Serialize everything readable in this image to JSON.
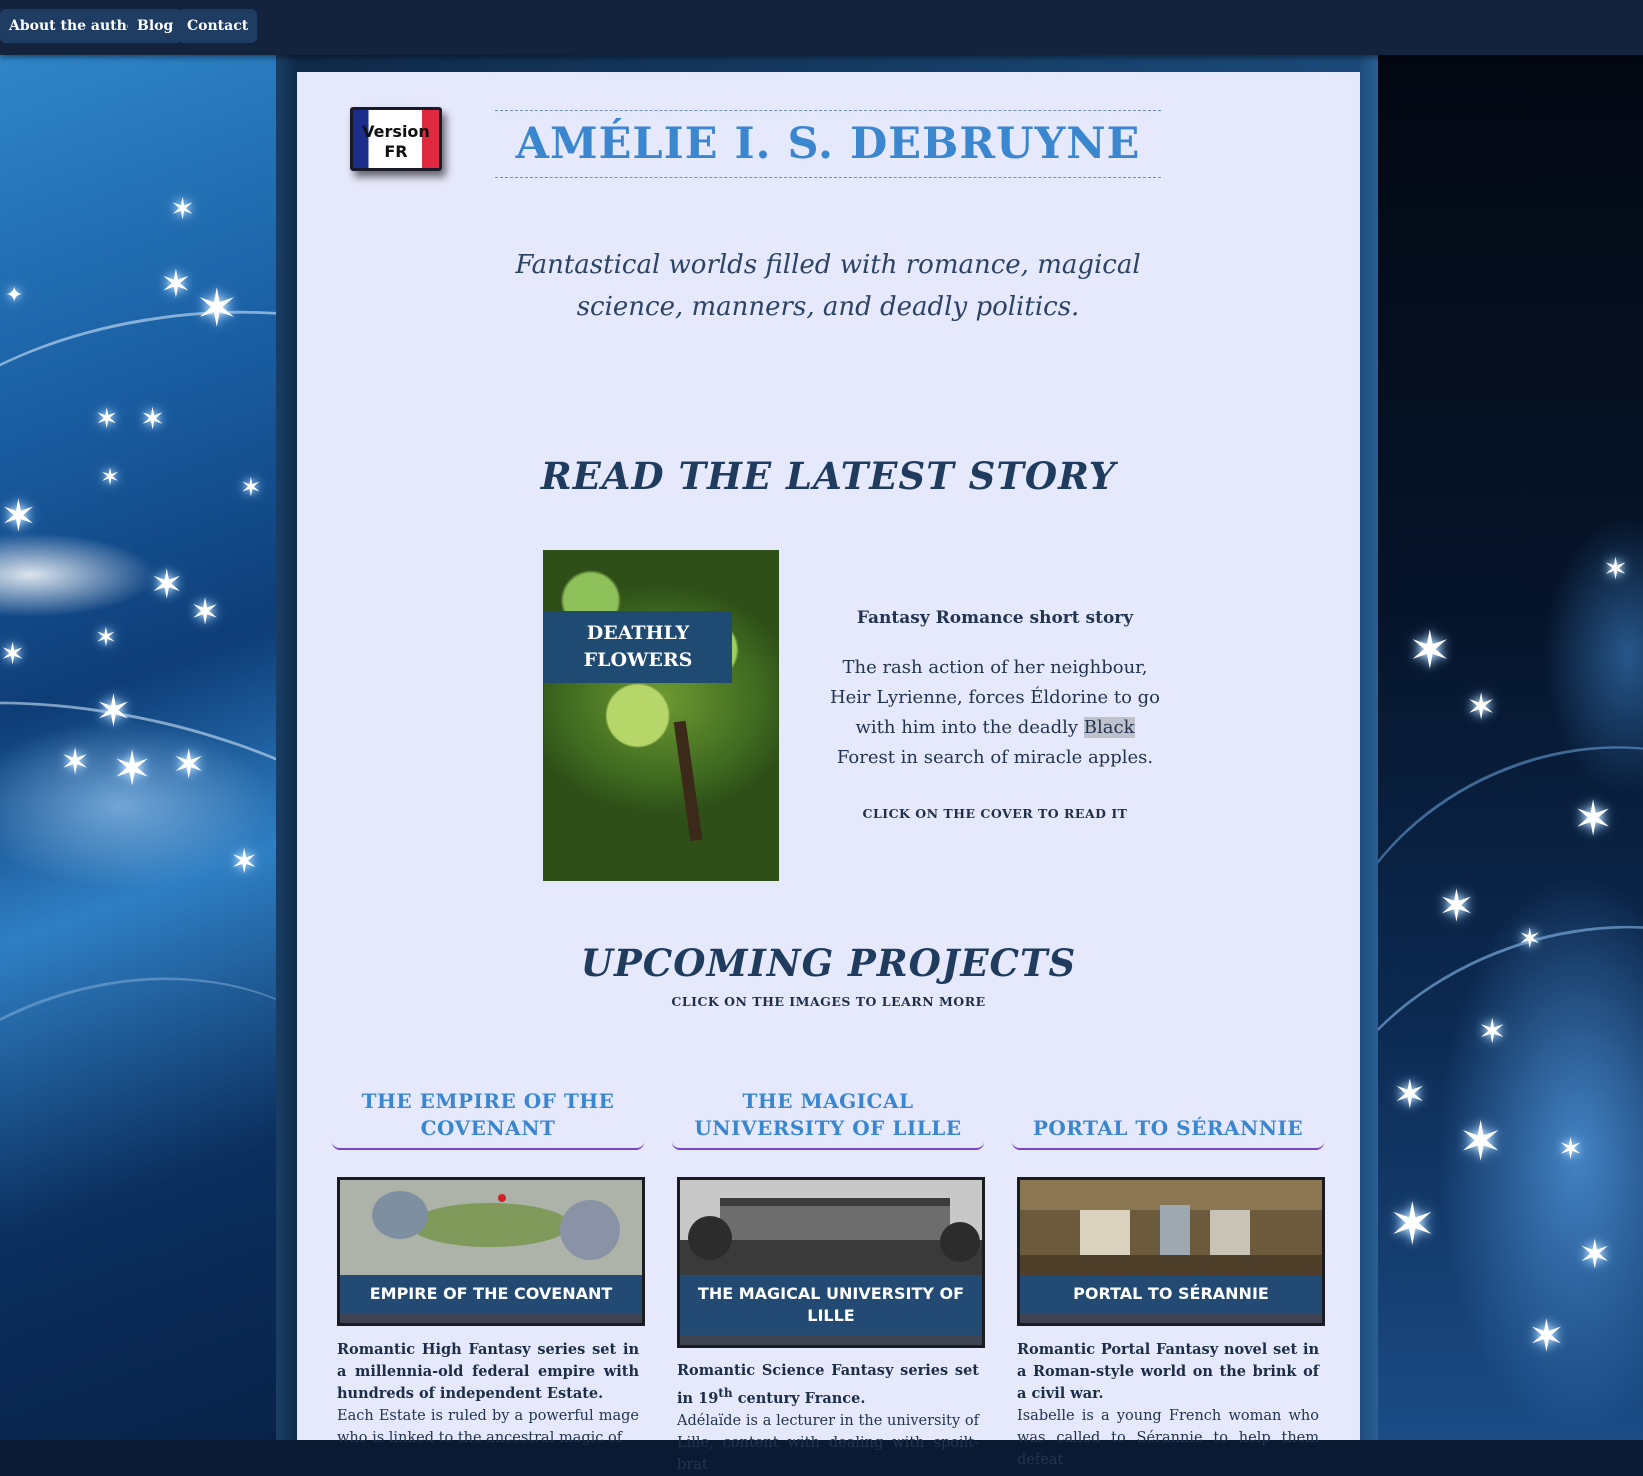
{
  "nav": {
    "items": [
      {
        "label": "About the author"
      },
      {
        "label": "Blog"
      },
      {
        "label": "Contact"
      }
    ]
  },
  "header": {
    "version_badge": "Version FR",
    "version_line1": "Version",
    "version_line2": "FR",
    "site_title": "AMÉLIE I. S. DEBRUYNE",
    "tagline": "Fantastical worlds filled with romance, magical science, manners, and deadly politics."
  },
  "latest": {
    "heading": "READ THE LATEST STORY",
    "cover_title_line1": "DEATHLY",
    "cover_title_line2": "FLOWERS",
    "kind": "Fantasy Romance short story",
    "desc_before": "The rash action of her neighbour, Heir Lyrienne, forces Éldorine to go with him into the deadly ",
    "desc_highlight": "Black",
    "desc_after": " Forest in search of miracle apples.",
    "cta": "CLICK ON THE COVER TO READ IT"
  },
  "upcoming": {
    "heading": "UPCOMING PROJECTS",
    "note": "CLICK ON THE IMAGES TO LEARN MORE",
    "projects": [
      {
        "title": "THE EMPIRE OF THE COVENANT",
        "caption": "EMPIRE OF THE COVENANT",
        "summary": "Romantic High Fantasy series set in a millennia-old federal empire with hundreds of independent Estate.",
        "body": "Each Estate is ruled by a powerful mage who is linked to the ancestral magic of"
      },
      {
        "title": "THE MAGICAL UNIVERSITY OF LILLE",
        "caption": "THE MAGICAL UNIVERSITY OF LILLE",
        "summary_before": "Romantic Science Fantasy series set in 19",
        "summary_sup": "th",
        "summary_after": " century France.",
        "body": "Adélaïde is a lecturer in the university of Lille, content with dealing with spoilt-brat"
      },
      {
        "title": "PORTAL TO SÉRANNIE",
        "caption": "PORTAL TO SÉRANNIE",
        "summary": "Romantic Portal Fantasy novel set in a Roman-style world on the brink of a civil war.",
        "body": "Isabelle is a young French woman who was called to Sérannie to help them defeat"
      }
    ]
  },
  "colors": {
    "title_blue": "#3a86cf",
    "nav_bg": "#13233d",
    "nav_button": "#1f3d63",
    "page_bg": "#e6e8fb",
    "accent_rule": "#7a46c6"
  }
}
